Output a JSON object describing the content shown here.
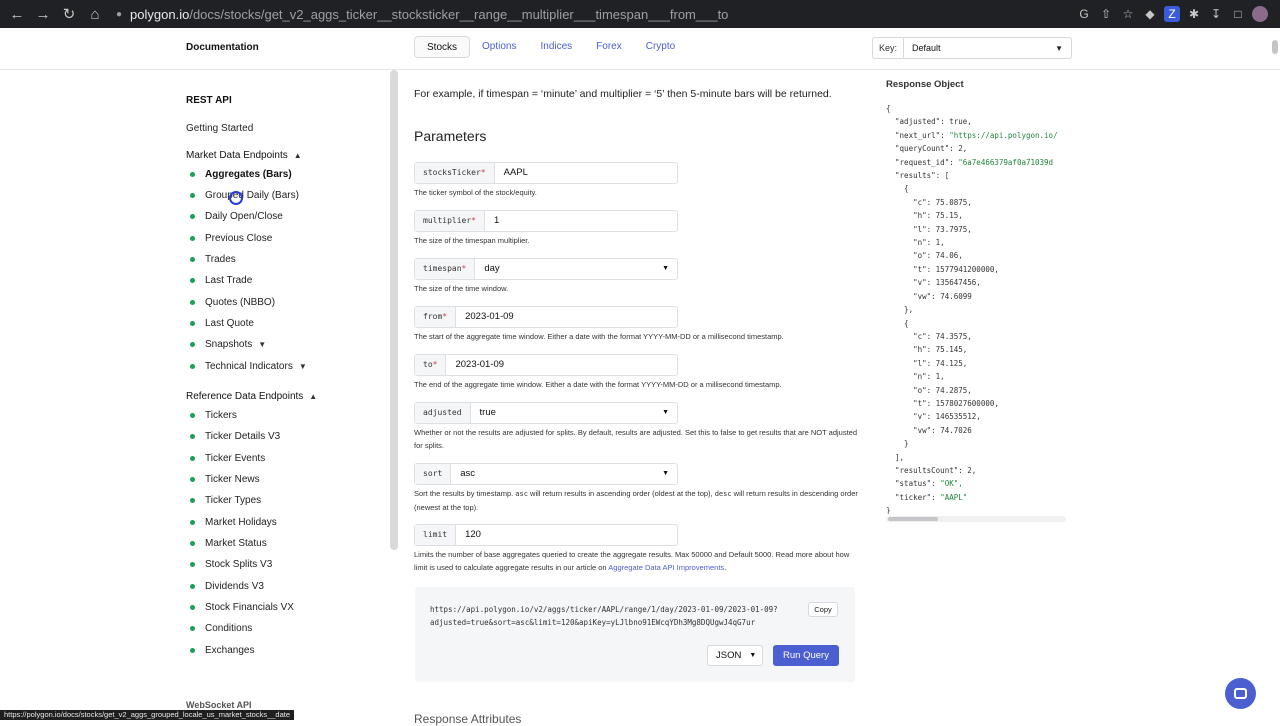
{
  "browser": {
    "url_host": "polygon.io",
    "url_path": "/docs/stocks/get_v2_aggs_ticker__stocksticker__range__multiplier___timespan___from___to"
  },
  "header": {
    "doc_title": "Documentation",
    "tabs": [
      {
        "label": "Stocks",
        "active": true
      },
      {
        "label": "Options",
        "active": false
      },
      {
        "label": "Indices",
        "active": false
      },
      {
        "label": "Forex",
        "active": false
      },
      {
        "label": "Crypto",
        "active": false
      }
    ],
    "key_label": "Key:",
    "key_value": "Default"
  },
  "sidebar": {
    "rest_api": "REST API",
    "getting_started": "Getting Started",
    "market_data": "Market Data Endpoints",
    "market_items": [
      "Aggregates (Bars)",
      "Grouped Daily (Bars)",
      "Daily Open/Close",
      "Previous Close",
      "Trades",
      "Last Trade",
      "Quotes (NBBO)",
      "Last Quote",
      "Snapshots",
      "Technical Indicators"
    ],
    "reference_data": "Reference Data Endpoints",
    "reference_items": [
      "Tickers",
      "Ticker Details V3",
      "Ticker Events",
      "Ticker News",
      "Ticker Types",
      "Market Holidays",
      "Market Status",
      "Stock Splits V3",
      "Dividends V3",
      "Stock Financials VX",
      "Conditions",
      "Exchanges"
    ],
    "cut_off": "WebSocket API"
  },
  "main": {
    "intro": "For example, if timespan = ‘minute’ and multiplier = ‘5’ then 5-minute bars will be returned.",
    "heading": "Parameters",
    "params": [
      {
        "name": "stocksTicker",
        "required": true,
        "value": "AAPL",
        "select": false,
        "desc": "The ticker symbol of the stock/equity."
      },
      {
        "name": "multiplier",
        "required": true,
        "value": "1",
        "select": false,
        "desc": "The size of the timespan multiplier."
      },
      {
        "name": "timespan",
        "required": true,
        "value": "day",
        "select": true,
        "desc": "The size of the time window."
      },
      {
        "name": "from",
        "required": true,
        "value": "2023-01-09",
        "select": false,
        "desc": "The start of the aggregate time window. Either a date with the format YYYY-MM-DD or a millisecond timestamp."
      },
      {
        "name": "to",
        "required": true,
        "value": "2023-01-09",
        "select": false,
        "desc": "The end of the aggregate time window. Either a date with the format YYYY-MM-DD or a millisecond timestamp."
      },
      {
        "name": "adjusted",
        "required": false,
        "value": "true",
        "select": true,
        "desc": "Whether or not the results are adjusted for splits. By default, results are adjusted. Set this to false to get results that are NOT adjusted for splits."
      },
      {
        "name": "sort",
        "required": false,
        "value": "asc",
        "select": true,
        "desc_pre": "Sort the results by timestamp. ",
        "desc_code1": "asc",
        "desc_mid": " will return results in ascending order (oldest at the top), ",
        "desc_code2": "desc",
        "desc_post": " will return results in descending order (newest at the top)."
      },
      {
        "name": "limit",
        "required": false,
        "value": "120",
        "select": false,
        "desc_pre": "Limits the number of base aggregates queried to create the aggregate results. Max 50000 and Default 5000. Read more about how limit is used to calculate aggregate results in our article on ",
        "desc_link": "Aggregate Data API Improvements",
        "desc_post": "."
      }
    ],
    "query_url_line1": "https://api.polygon.io/v2/aggs/ticker/AAPL/range/1/day/2023-01-09/2023-01-09?",
    "query_url_line2": "adjusted=true&sort=asc&limit=120&apiKey=yLJlbno91EWcqYDh3Mg8DQUgwJ4qG7ur",
    "copy_label": "Copy",
    "format_value": "JSON",
    "run_label": "Run Query",
    "cut_off": "Response Attributes"
  },
  "response": {
    "title": "Response Object",
    "lines": [
      "{",
      "  \"adjusted\": true,",
      "  \"next_url\": \"https://api.polygon.io/",
      "  \"queryCount\": 2,",
      "  \"request_id\": \"6a7e466379af0a71039d",
      "  \"results\": [",
      "    {",
      "      \"c\": 75.0875,",
      "      \"h\": 75.15,",
      "      \"l\": 73.7975,",
      "      \"n\": 1,",
      "      \"o\": 74.06,",
      "      \"t\": 1577941200000,",
      "      \"v\": 135647456,",
      "      \"vw\": 74.6099",
      "    },",
      "    {",
      "      \"c\": 74.3575,",
      "      \"h\": 75.145,",
      "      \"l\": 74.125,",
      "      \"n\": 1,",
      "      \"o\": 74.2875,",
      "      \"t\": 1578027600000,",
      "      \"v\": 146535512,",
      "      \"vw\": 74.7026",
      "    }",
      "  ],",
      "  \"resultsCount\": 2,",
      "  \"status\": \"OK\",",
      "  \"ticker\": \"AAPL\"",
      "}"
    ]
  },
  "status_bar": "https://polygon.io/docs/stocks/get_v2_aggs_grouped_locale_us_market_stocks__date",
  "colors": {
    "accent": "#4b5fd1",
    "dot": "#1a9e5a"
  }
}
